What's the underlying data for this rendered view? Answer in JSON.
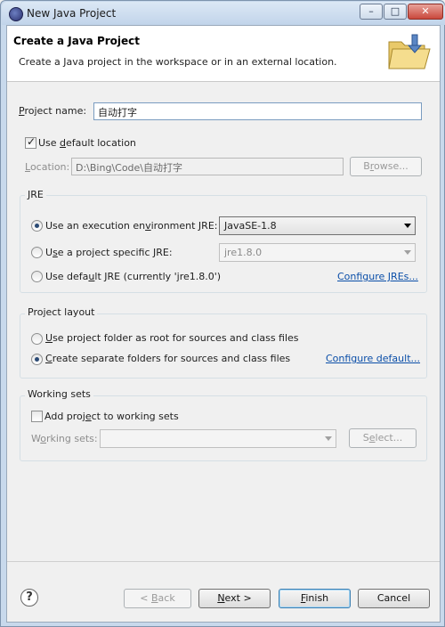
{
  "window": {
    "title": "New Java Project",
    "controls": {
      "minimize": "–",
      "maximize": "□",
      "close": "✕"
    }
  },
  "header": {
    "title": "Create a Java Project",
    "description": "Create a Java project in the workspace or in an external location.",
    "icon": "java-project-folder-icon"
  },
  "project": {
    "name_label_pre": "",
    "name_label_mnemonic": "P",
    "name_label_post": "roject name:",
    "name_value": "自动打字"
  },
  "location": {
    "use_default_pre": "Use ",
    "use_default_mnemonic": "d",
    "use_default_post": "efault location",
    "use_default_checked": true,
    "label_pre": "",
    "label_mnemonic": "L",
    "label_post": "ocation:",
    "value": "D:\\Bing\\Code\\自动打字",
    "browse_pre": "B",
    "browse_mnemonic": "r",
    "browse_post": "owse..."
  },
  "jre": {
    "group_title": "JRE",
    "opt1_pre": "Use an execution en",
    "opt1_mnemonic": "v",
    "opt1_post": "ironment JRE:",
    "opt1_selected": true,
    "opt1_value": "JavaSE-1.8",
    "opt2_pre": "U",
    "opt2_mnemonic": "s",
    "opt2_post": "e a project specific JRE:",
    "opt2_value": "jre1.8.0",
    "opt3_pre": "Use defa",
    "opt3_mnemonic": "u",
    "opt3_post": "lt JRE (currently 'jre1.8.0')",
    "configure_link": "Configure JREs..."
  },
  "layout": {
    "group_title": "Project layout",
    "opt1_pre": "",
    "opt1_mnemonic": "U",
    "opt1_post": "se project folder as root for sources and class files",
    "opt2_pre": "",
    "opt2_mnemonic": "C",
    "opt2_post": "reate separate folders for sources and class files",
    "opt2_selected": true,
    "configure_link": "Configure default..."
  },
  "working_sets": {
    "group_title": "Working sets",
    "add_pre": "Add proj",
    "add_mnemonic": "e",
    "add_post": "ct to working sets",
    "add_checked": false,
    "label_pre": "W",
    "label_mnemonic": "o",
    "label_post": "rking sets:",
    "value": "",
    "select_pre": "S",
    "select_mnemonic": "e",
    "select_post": "lect..."
  },
  "footer": {
    "help": "?",
    "back_pre": "< ",
    "back_mnemonic": "B",
    "back_post": "ack",
    "next_pre": "",
    "next_mnemonic": "N",
    "next_post": "ext >",
    "finish_pre": "",
    "finish_mnemonic": "F",
    "finish_post": "inish",
    "cancel": "Cancel"
  },
  "colors": {
    "link": "#0a4ea8",
    "frame": "#c8d9ec",
    "header_bg": "#ffffff"
  }
}
